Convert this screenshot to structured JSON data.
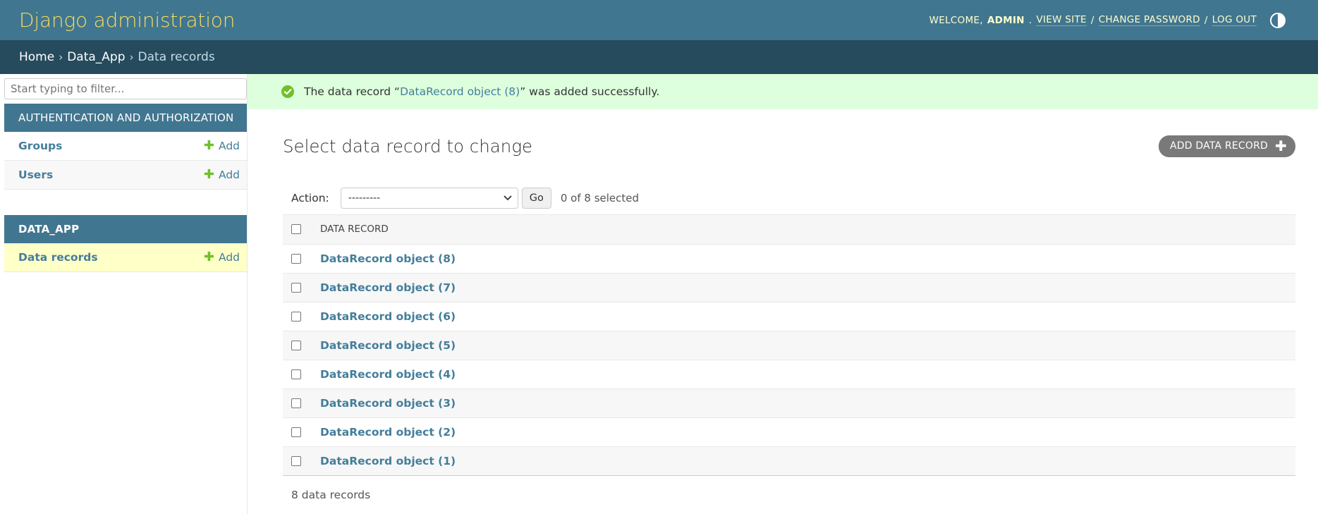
{
  "header": {
    "branding": "Django administration",
    "welcome_prefix": "WELCOME,",
    "username": "ADMIN",
    "view_site": "VIEW SITE",
    "change_password": "CHANGE PASSWORD",
    "log_out": "LOG OUT",
    "separator": "/"
  },
  "breadcrumbs": {
    "home": "Home",
    "app": "Data_App",
    "current": "Data records",
    "arrow": "›"
  },
  "sidebar": {
    "filter_placeholder": "Start typing to filter...",
    "modules": [
      {
        "caption": "AUTHENTICATION AND AUTHORIZATION",
        "models": [
          {
            "name": "Groups",
            "add": "Add"
          },
          {
            "name": "Users",
            "add": "Add"
          }
        ]
      },
      {
        "caption": "DATA_APP",
        "models": [
          {
            "name": "Data records",
            "add": "Add"
          }
        ]
      }
    ]
  },
  "message": {
    "prefix": "The data record “",
    "link": "DataRecord object (8)",
    "suffix": "” was added successfully."
  },
  "main": {
    "title": "Select data record to change",
    "add_button": "ADD DATA RECORD",
    "action_label": "Action:",
    "action_value": "---------",
    "go_label": "Go",
    "selected_count": "0 of 8 selected",
    "column_header": "DATA RECORD",
    "rows": [
      "DataRecord object (8)",
      "DataRecord object (7)",
      "DataRecord object (6)",
      "DataRecord object (5)",
      "DataRecord object (4)",
      "DataRecord object (3)",
      "DataRecord object (2)",
      "DataRecord object (1)"
    ],
    "paginator": "8 data records"
  },
  "colors": {
    "header_bg": "#417690",
    "breadcrumb_bg": "#264b5d",
    "branding": "#f5dd5d",
    "link": "#447e9b",
    "success_bg": "#ddffdd",
    "add_icon": "#70bf2b",
    "current_model_bg": "#ffffc8"
  },
  "icons": {
    "theme": "half-circle-contrast-icon",
    "success": "check-circle-icon",
    "add": "plus-icon",
    "select": "chevron-down-icon"
  }
}
